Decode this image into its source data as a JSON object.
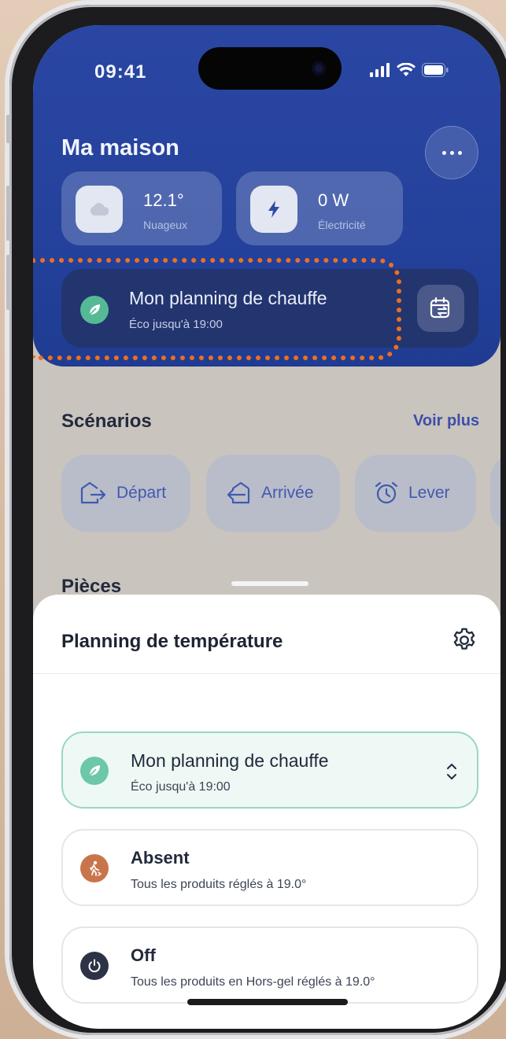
{
  "status": {
    "time": "09:41"
  },
  "header": {
    "title": "Ma maison"
  },
  "stats": [
    {
      "value": "12.1°",
      "label": "Nuageux",
      "icon": "cloud-icon"
    },
    {
      "value": "0 W",
      "label": "Électricité",
      "icon": "lightning-icon"
    }
  ],
  "planning": {
    "title": "Mon planning de chauffe",
    "subtitle": "Éco jusqu'à 19:00"
  },
  "scenarios": {
    "title": "Scénarios",
    "more_label": "Voir plus",
    "items": [
      {
        "label": "Départ",
        "icon": "leave-home-icon"
      },
      {
        "label": "Arrivée",
        "icon": "arrive-home-icon"
      },
      {
        "label": "Lever",
        "icon": "alarm-clock-icon"
      }
    ]
  },
  "rooms": {
    "title": "Pièces"
  },
  "sheet": {
    "title": "Planning de température",
    "options": [
      {
        "title": "Mon planning de chauffe",
        "subtitle": "Éco jusqu'à 19:00",
        "icon": "leaf-icon",
        "selected": true
      },
      {
        "title": "Absent",
        "subtitle": "Tous les produits réglés à 19.0°",
        "icon": "walking-person-icon"
      },
      {
        "title": "Off",
        "subtitle": "Tous les produits en Hors-gel réglés à 19.0°",
        "icon": "power-icon"
      }
    ]
  },
  "colors": {
    "accent": "#3c4fa8",
    "eco": "#56b996",
    "absent": "#c9754b",
    "off": "#2d3347",
    "highlight": "#ee6f1f"
  }
}
